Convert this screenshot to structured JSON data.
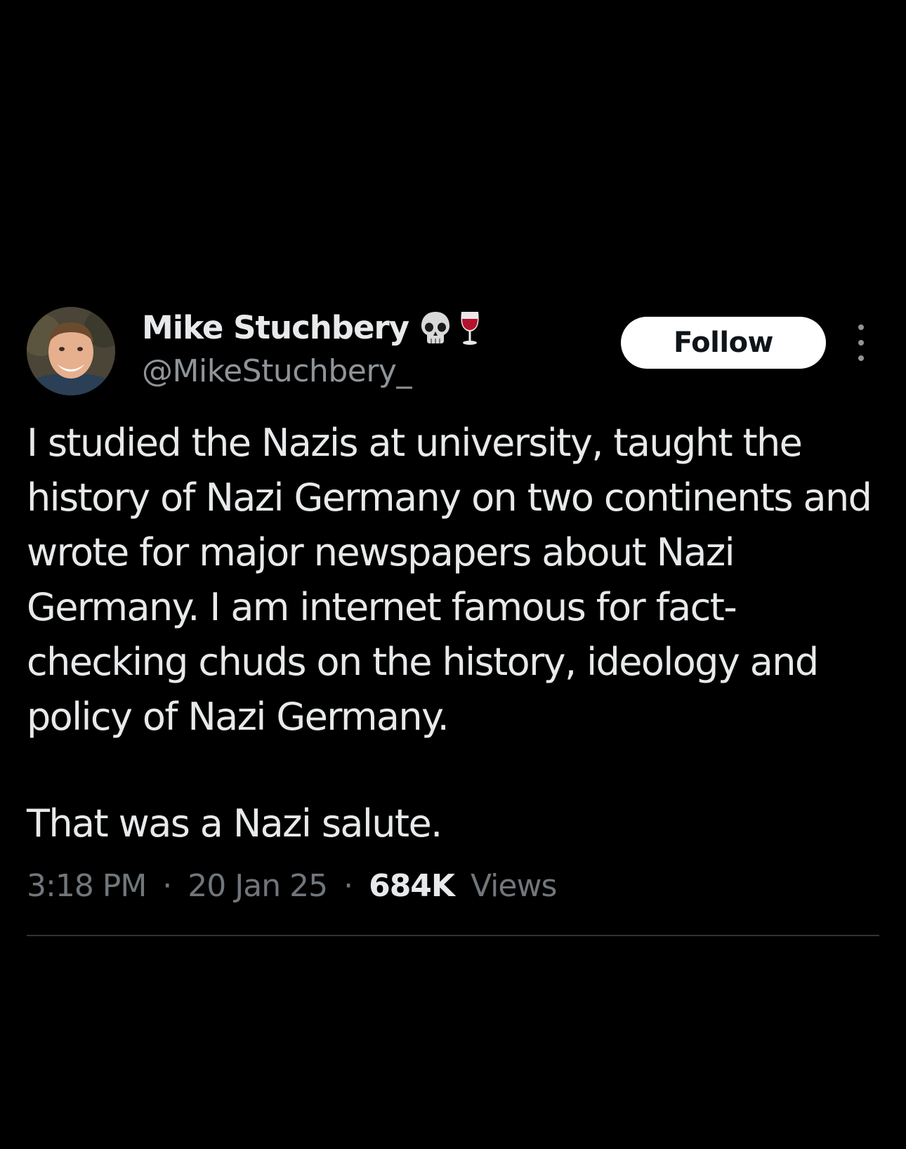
{
  "tweet": {
    "author": {
      "display_name": "Mike Stuchbery",
      "name_emojis": [
        "skull-icon",
        "wine-glass-icon"
      ],
      "handle": "@MikeStuchbery_"
    },
    "follow_label": "Follow",
    "text_paragraph_1": "I studied the Nazis at university, taught the history of Nazi Germany on two continents and wrote for major newspapers about Nazi Germany. I am internet famous for fact-checking chuds on the history, ideology and policy of Nazi Germany.",
    "text_paragraph_2": "That was a Nazi salute.",
    "meta": {
      "time": "3:18 PM",
      "separator": "·",
      "date": "20 Jan 25",
      "views_count": "684K",
      "views_label": "Views"
    }
  },
  "colors": {
    "background": "#000000",
    "primary_text": "#e7e9ea",
    "secondary_text": "#71767b",
    "follow_button_bg": "#ffffff",
    "divider": "#2f3336"
  }
}
